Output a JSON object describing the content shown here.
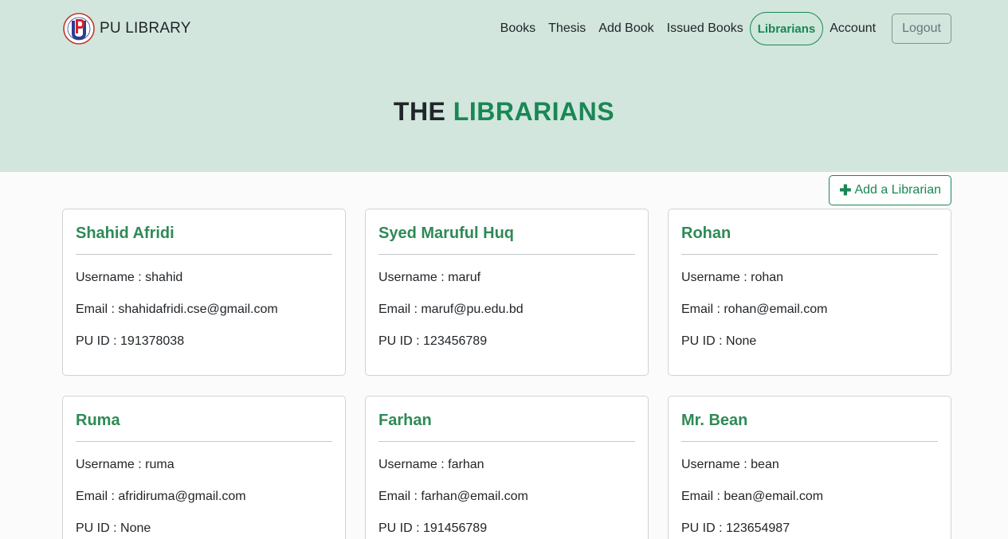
{
  "brand": {
    "name": "PU LIBRARY",
    "logo_letters": "PU"
  },
  "nav": {
    "items": [
      {
        "label": "Books"
      },
      {
        "label": "Thesis"
      },
      {
        "label": "Add Book"
      },
      {
        "label": "Issued Books"
      },
      {
        "label": "Librarians",
        "active": true
      },
      {
        "label": "Account"
      }
    ],
    "logout_label": "Logout"
  },
  "page": {
    "title_prefix": "THE",
    "title_accent": "LIBRARIANS"
  },
  "add_button": {
    "icon": "plus-icon",
    "label": "Add a Librarian"
  },
  "labels": {
    "username": "Username : ",
    "email": "Email : ",
    "pu_id": "PU ID : "
  },
  "librarians": [
    {
      "name": "Shahid Afridi",
      "username": "shahid",
      "email": "shahidafridi.cse@gmail.com",
      "pu_id": "191378038"
    },
    {
      "name": "Syed Maruful Huq",
      "username": "maruf",
      "email": "maruf@pu.edu.bd",
      "pu_id": "123456789"
    },
    {
      "name": "Rohan",
      "username": "rohan",
      "email": "rohan@email.com",
      "pu_id": "None"
    },
    {
      "name": "Ruma",
      "username": "ruma",
      "email": "afridiruma@gmail.com",
      "pu_id": "None"
    },
    {
      "name": "Farhan",
      "username": "farhan",
      "email": "farhan@email.com",
      "pu_id": "191456789"
    },
    {
      "name": "Mr. Bean",
      "username": "bean",
      "email": "bean@email.com",
      "pu_id": "123654987"
    }
  ],
  "colors": {
    "accent": "#198754",
    "header_bg": "#d2e6dd",
    "card_title": "#2e8a56"
  }
}
